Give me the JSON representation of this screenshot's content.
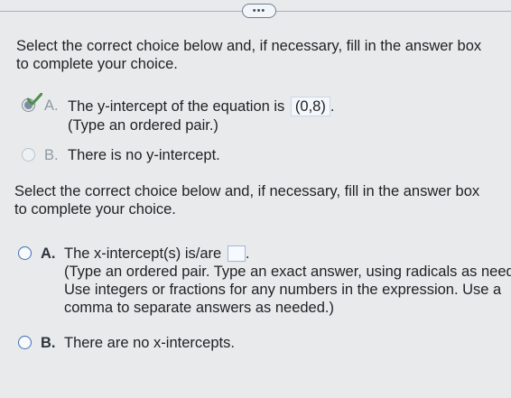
{
  "toolbar": {
    "more_label": "•••"
  },
  "question1": {
    "prompt": "Select the correct choice below and, if necessary, fill in the answer box to complete your choice.",
    "choices": [
      {
        "letter": "A.",
        "text": "The y-intercept of the equation is",
        "value": "(0,8)",
        "suffix": ".",
        "hint": "(Type an ordered pair.)"
      },
      {
        "letter": "B.",
        "text": "There is no y-intercept."
      }
    ]
  },
  "question2": {
    "prompt": "Select the correct choice below and, if necessary, fill in the answer box to complete your choice.",
    "choices": [
      {
        "letter": "A.",
        "text": "The x-intercept(s) is/are",
        "suffix": ".",
        "hint_lines": [
          "(Type an ordered pair. Type an exact answer, using radicals as needed.",
          "Use integers or fractions for any numbers in the expression. Use a",
          "comma to separate answers as needed.)"
        ]
      },
      {
        "letter": "B.",
        "text": "There are no x-intercepts."
      }
    ]
  },
  "colors": {
    "page_background": "#e9eaec",
    "selected_check": "#4d8f4a",
    "radio_border_active": "#3d6fb3"
  },
  "icons": {
    "more": "ellipsis-icon",
    "selected": "checkmark-icon"
  }
}
